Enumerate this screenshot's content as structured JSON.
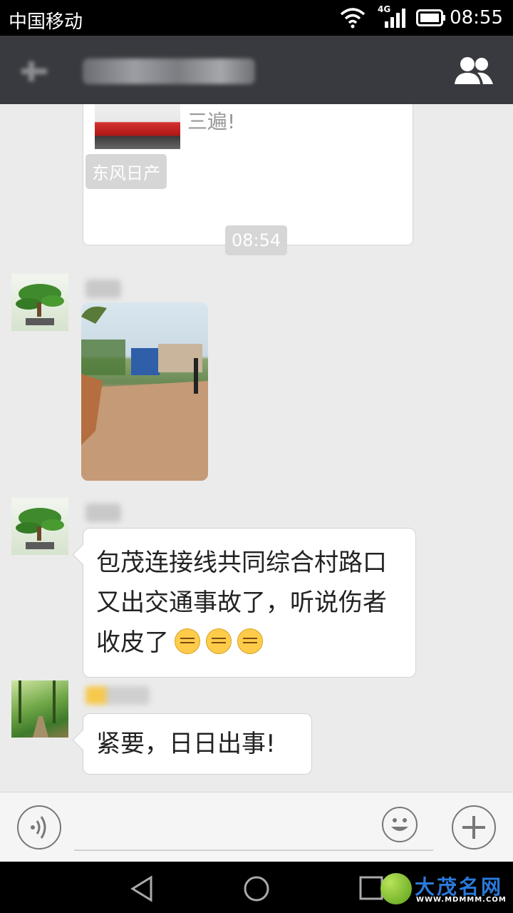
{
  "status_bar": {
    "carrier": "中国移动",
    "network": "4G",
    "time": "08:55",
    "icons": [
      "wifi-icon",
      "signal-icon",
      "battery-icon"
    ]
  },
  "title_bar": {
    "icons": [
      "back-icon",
      "group-members-icon"
    ]
  },
  "chat": {
    "link_card_text": "三遍!",
    "sys_label": "东风日产",
    "timestamp": "08:54",
    "messages": [
      {
        "type": "image",
        "avatar": "bonsai-tree"
      },
      {
        "type": "text",
        "avatar": "bonsai-tree",
        "text_line1": "包茂连接线共同综合村路口",
        "text_line2": "又出交通事故了，听说伤者",
        "text_line3": "收皮了"
      },
      {
        "type": "text",
        "avatar": "forest-path",
        "text": "紧要，日日出事!"
      }
    ]
  },
  "input_bar": {
    "icons": [
      "voice-icon",
      "emoji-icon",
      "plus-icon"
    ]
  },
  "nav_bar": {
    "icons": [
      "back-triangle-icon",
      "home-circle-icon",
      "recents-square-icon"
    ]
  },
  "watermark": {
    "text": "大茂名网",
    "url": "WWW.MDMMM.COM"
  },
  "colors": {
    "title_bar": "#393a3f",
    "chat_bg": "#ebebeb",
    "sys_tag": "#d6d6d6"
  }
}
